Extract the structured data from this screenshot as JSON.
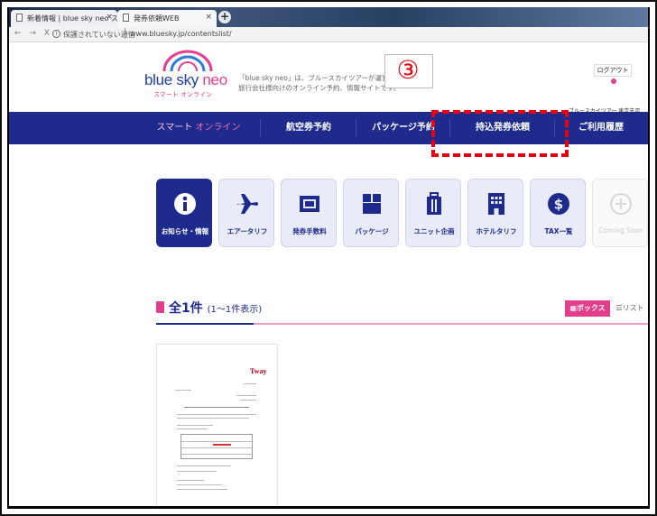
{
  "browser": {
    "tabs": [
      {
        "title": "新着情報 | blue sky neo スマー"
      },
      {
        "title": "発券依頼WEB"
      }
    ],
    "new_tab": "+",
    "nav_buttons": "← → X",
    "security_warning": "保護されていない通信",
    "url": "www.bluesky.jp/contentslist/"
  },
  "site": {
    "logo_text_a": "blue sky ",
    "logo_text_b": "neo",
    "logo_sub": "スマート オンライン",
    "tagline": [
      "「blue sky neo」は、ブルースカイツアーが運営する",
      "旅行会社様向けのオンライン予約、情報サイトです。"
    ],
    "step_marker": "③",
    "logout": "ログアウト",
    "company": "ブルースカイツアー 東京支店"
  },
  "navbar": {
    "brand_a": "スマート ",
    "brand_b": "オンライン",
    "items": [
      "航空券予約",
      "パッケージ予約",
      "持込発券依頼",
      "ご利用履歴"
    ]
  },
  "tiles": [
    {
      "label": "お知らせ・情報",
      "icon": "info-icon"
    },
    {
      "label": "エアータリフ",
      "icon": "airplane-icon"
    },
    {
      "label": "発券手数料",
      "icon": "ticket-icon"
    },
    {
      "label": "パッケージ",
      "icon": "package-icon"
    },
    {
      "label": "ユニット企画",
      "icon": "luggage-icon"
    },
    {
      "label": "ホテルタリフ",
      "icon": "hotel-icon"
    },
    {
      "label": "TAX一覧",
      "icon": "dollar-icon"
    },
    {
      "label": "Coming Soon",
      "icon": "plus-icon"
    }
  ],
  "results": {
    "count": "全1件",
    "range": "(1〜1件表示)",
    "view_box": "ボックス",
    "view_list": "リスト"
  },
  "document_card": {
    "brand": "Tway"
  },
  "colors": {
    "navy": "#1e2b8c",
    "pink": "#e23e8c",
    "annotation_red": "#e60012"
  }
}
